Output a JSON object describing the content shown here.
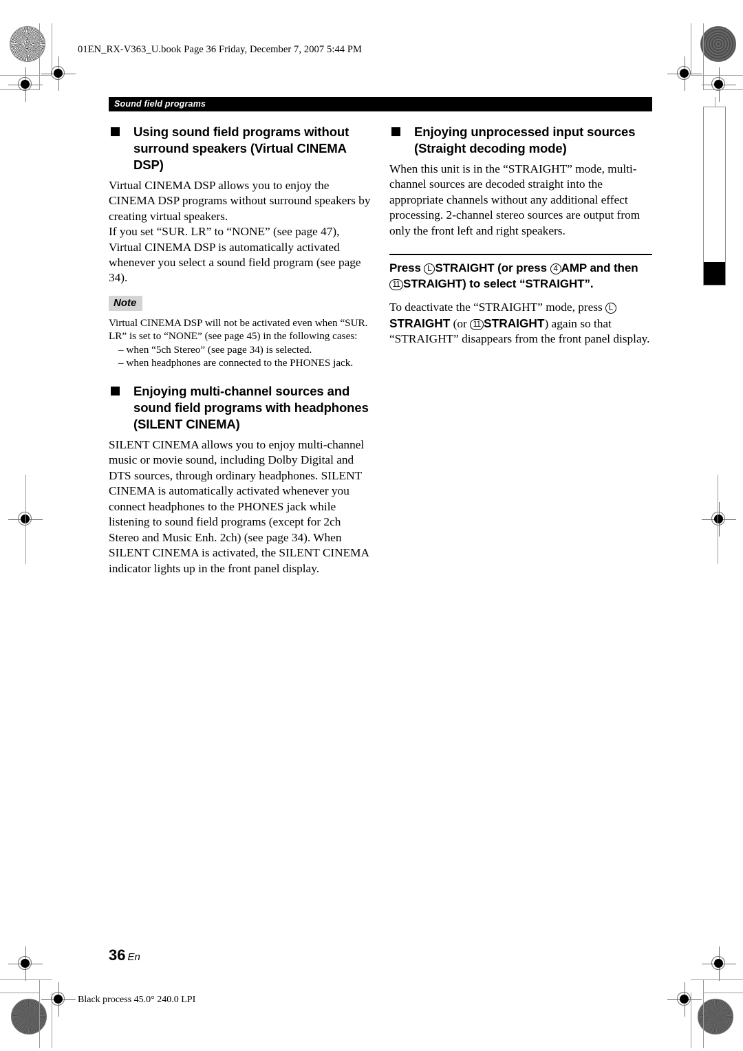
{
  "page": {
    "file_header": "01EN_RX-V363_U.book  Page 36  Friday, December 7, 2007  5:44 PM",
    "section_bar": "Sound field programs",
    "page_number": "36",
    "page_language": "En",
    "print_note": "Black process 45.0° 240.0 LPI"
  },
  "left_column": {
    "heading1": {
      "line1": "Using sound field programs without",
      "line2": "surround speakers (Virtual CINEMA DSP)"
    },
    "paragraph1": "Virtual CINEMA DSP allows you to enjoy the CINEMA DSP programs without surround speakers by creating virtual speakers.",
    "paragraph2": "If you set “SUR. LR” to “NONE” (see page 47), Virtual CINEMA DSP is automatically activated whenever you select a sound field program (see page 34).",
    "note": {
      "label": "Note",
      "text": "Virtual CINEMA DSP will not be activated even when “SUR. LR” is set to “NONE” (see page 45) in the following cases:",
      "bullets": [
        "– when “5ch Stereo” (see page 34) is selected.",
        "– when headphones are connected to the PHONES jack."
      ]
    },
    "heading2": {
      "line1": "Enjoying multi-channel sources and",
      "line2": "sound field programs with headphones",
      "line3": "(SILENT CINEMA)"
    },
    "paragraph3": "SILENT CINEMA allows you to enjoy multi-channel music or movie sound, including Dolby Digital and DTS sources, through ordinary headphones. SILENT CINEMA is automatically activated whenever you connect headphones to the PHONES jack while listening to sound field programs (except for 2ch Stereo and Music Enh. 2ch) (see page 34). When SILENT CINEMA is activated, the SILENT CINEMA indicator lights up in the front panel display."
  },
  "right_column": {
    "heading1": {
      "line1": "Enjoying unprocessed input sources",
      "line2": "(Straight decoding mode)"
    },
    "paragraph1": "When this unit is in the “STRAIGHT” mode, multi-channel sources are decoded straight into the appropriate channels without any additional effect processing. 2-channel stereo sources are output from only the front left and right speakers.",
    "instruction": {
      "press": "Press ",
      "marker_l": "L",
      "button_straight": "STRAIGHT",
      "or_press": " (or press ",
      "marker_4": "4",
      "button_amp": "AMP",
      "and_then": " and then ",
      "marker_11": "11",
      "button_straight2": "STRAIGHT",
      "tail": ") to select “STRAIGHT”."
    },
    "deactivate": {
      "lead": "To deactivate the “STRAIGHT” mode, press ",
      "marker_l": "L",
      "button_straight": "STRAIGHT",
      "or": " (or ",
      "marker_11": "11",
      "button_straight2": "STRAIGHT",
      "tail": ") again so that “STRAIGHT” disappears from the front panel display."
    }
  }
}
